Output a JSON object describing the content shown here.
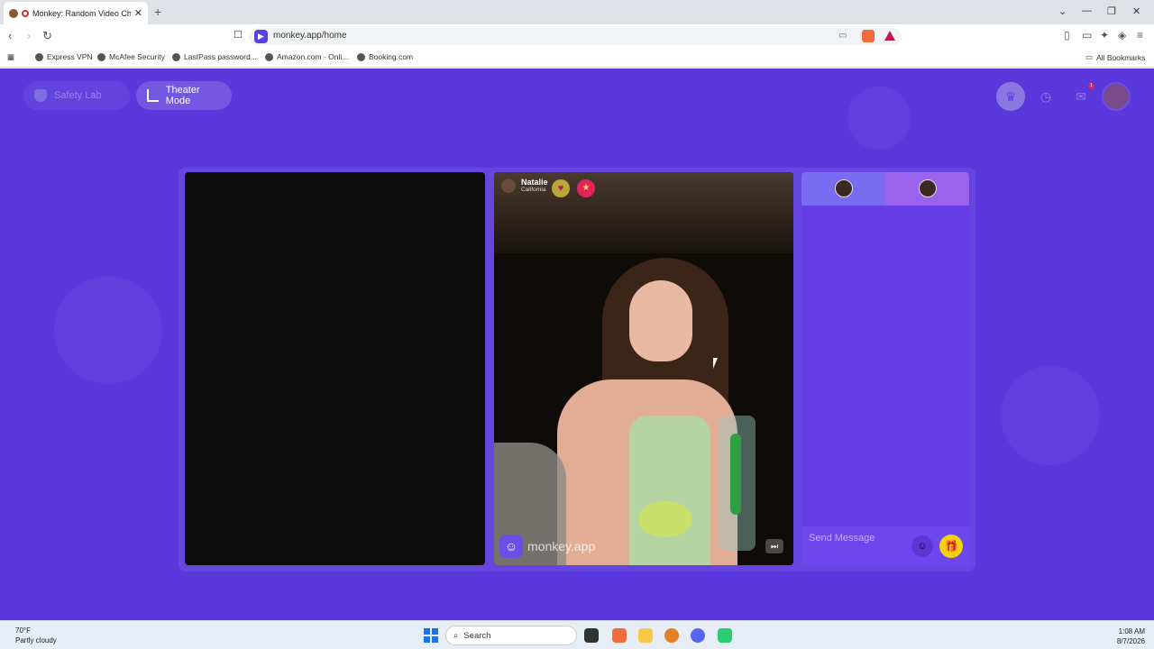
{
  "browser": {
    "tab_title": "Monkey: Random Video Chat",
    "tab_close": "✕",
    "new_tab": "+",
    "url": "monkey.app/home",
    "window_controls": [
      "⌄",
      "—",
      "❐",
      "✕"
    ],
    "bookmarks": [
      "Express VPN",
      "McAfee Security",
      "LastPass password...",
      "Amazon.com - Onli...",
      "Booking.com"
    ],
    "all_bookmarks": "All Bookmarks"
  },
  "page": {
    "safety_lab_label": "Safety Lab",
    "theater_mode_label": "Theater Mode",
    "notification_count": "1",
    "remote_user": {
      "name": "Natalie",
      "location": "California"
    },
    "watermark": "monkey.app",
    "chat": {
      "send_placeholder": "Send Message"
    }
  },
  "taskbar": {
    "temperature": "70°F",
    "weather": "Partly cloudy",
    "search_label": "Search",
    "time": "1:08 AM",
    "date": "8/7/2026"
  },
  "colors": {
    "brand_purple": "#5a38dc",
    "gift_yellow": "#f5d10a",
    "alert_pink": "#e2245e"
  }
}
